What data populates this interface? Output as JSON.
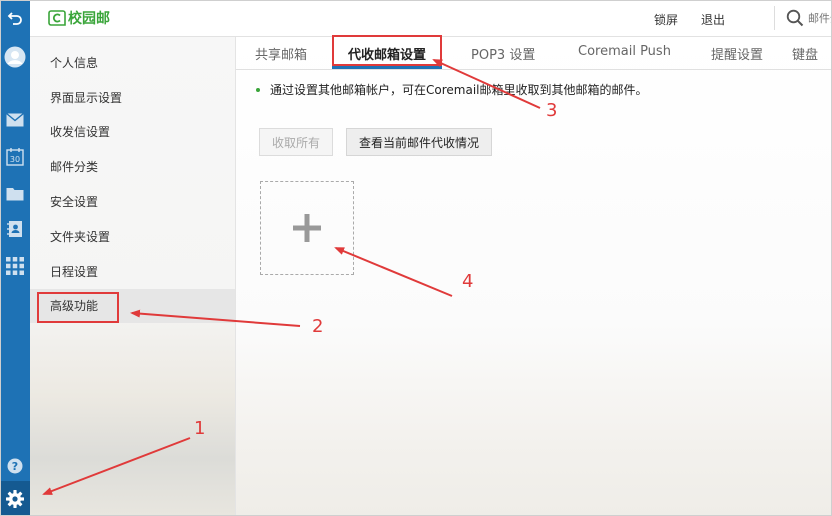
{
  "app": {
    "logo_text": "校园邮"
  },
  "header": {
    "lock_label": "锁屏",
    "logout_label": "退出",
    "search_placeholder": "邮件全文"
  },
  "rail": {
    "icons": [
      "back-arrow-icon",
      "avatar-icon",
      "mail-icon",
      "calendar-icon",
      "folder-icon",
      "contacts-icon",
      "apps-grid-icon",
      "help-icon",
      "settings-gear-icon"
    ],
    "calendar_day": "30"
  },
  "sidebar": {
    "items": [
      {
        "label": "个人信息"
      },
      {
        "label": "界面显示设置"
      },
      {
        "label": "收发信设置"
      },
      {
        "label": "邮件分类"
      },
      {
        "label": "安全设置"
      },
      {
        "label": "文件夹设置"
      },
      {
        "label": "日程设置"
      },
      {
        "label": "高级功能"
      }
    ],
    "active_index": 7
  },
  "tabs": [
    {
      "label": "共享邮箱"
    },
    {
      "label": "代收邮箱设置"
    },
    {
      "label": "POP3 设置"
    },
    {
      "label": "Coremail Push"
    },
    {
      "label": "提醒设置"
    },
    {
      "label": "键盘"
    }
  ],
  "active_tab": 1,
  "main": {
    "info_text": "通过设置其他邮箱帐户，可在Coremail邮箱里收取到其他邮箱的邮件。",
    "fetch_all_label": "收取所有",
    "view_status_label": "查看当前邮件代收情况"
  },
  "annotations": {
    "numbers": [
      "1",
      "2",
      "3",
      "4"
    ],
    "color": "#e03a3a"
  },
  "colors": {
    "accent": "#1e72b5",
    "brand_green": "#3aa53a",
    "annotation_red": "#e03a3a"
  }
}
